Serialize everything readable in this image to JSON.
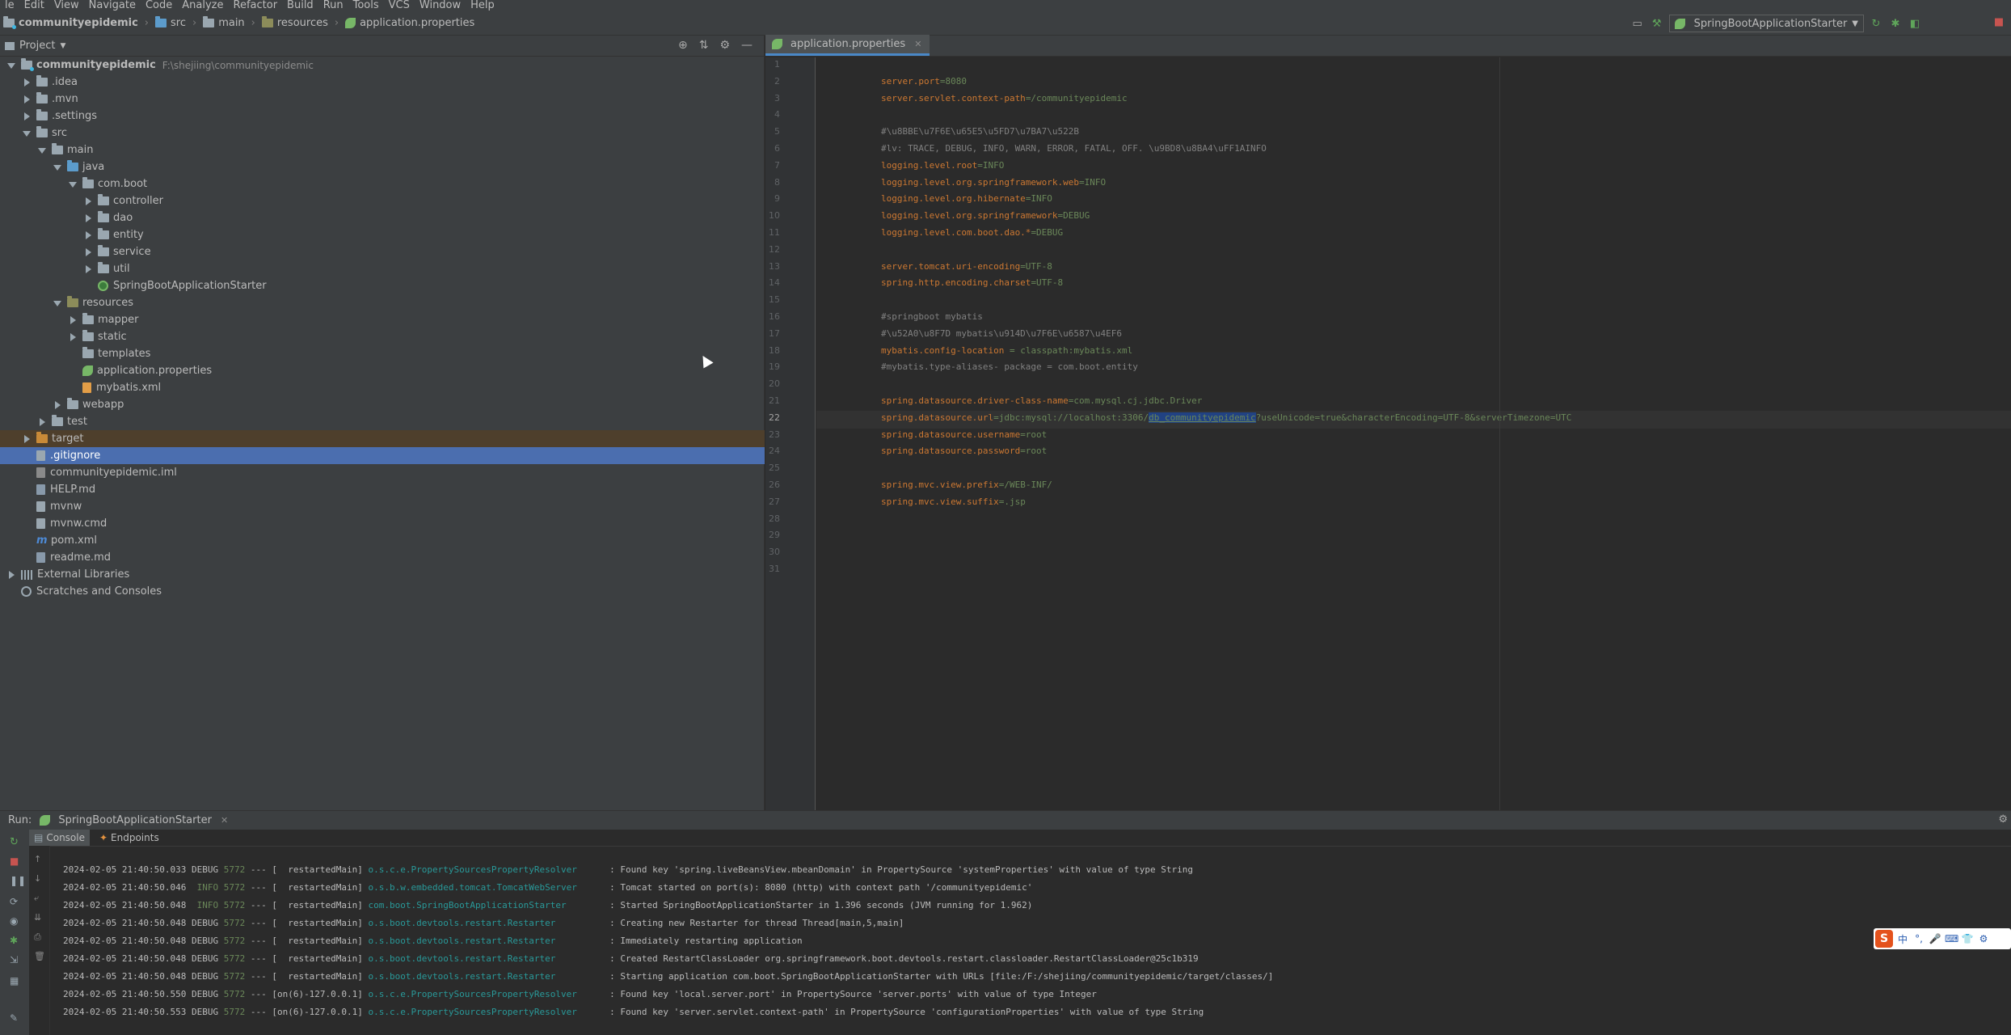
{
  "menu": [
    "le",
    "Edit",
    "View",
    "Navigate",
    "Code",
    "Analyze",
    "Refactor",
    "Build",
    "Run",
    "Tools",
    "VCS",
    "Window",
    "Help"
  ],
  "breadcrumbs": [
    "communityepidemic",
    "src",
    "main",
    "resources",
    "application.properties"
  ],
  "run_config": {
    "name": "SpringBootApplicationStarter"
  },
  "project_pane": {
    "title": "Project",
    "tree": [
      {
        "label": "communityepidemic",
        "path": "F:\\shejiing\\communityepidemic"
      },
      {
        "label": ".idea"
      },
      {
        "label": ".mvn"
      },
      {
        "label": ".settings"
      },
      {
        "label": "src"
      },
      {
        "label": "main"
      },
      {
        "label": "java"
      },
      {
        "label": "com.boot"
      },
      {
        "label": "controller"
      },
      {
        "label": "dao"
      },
      {
        "label": "entity"
      },
      {
        "label": "service"
      },
      {
        "label": "util"
      },
      {
        "label": "SpringBootApplicationStarter"
      },
      {
        "label": "resources"
      },
      {
        "label": "mapper"
      },
      {
        "label": "static"
      },
      {
        "label": "templates"
      },
      {
        "label": "application.properties"
      },
      {
        "label": "mybatis.xml"
      },
      {
        "label": "webapp"
      },
      {
        "label": "test"
      },
      {
        "label": "target"
      },
      {
        "label": ".gitignore"
      },
      {
        "label": "communityepidemic.iml"
      },
      {
        "label": "HELP.md"
      },
      {
        "label": "mvnw"
      },
      {
        "label": "mvnw.cmd"
      },
      {
        "label": "pom.xml"
      },
      {
        "label": "readme.md"
      },
      {
        "label": "External Libraries"
      },
      {
        "label": "Scratches and Consoles"
      }
    ]
  },
  "editor": {
    "tab": "application.properties",
    "lines": [
      "",
      "server.port=8080",
      "server.servlet.context-path=/communityepidemic",
      "",
      "#\\u8BBE\\u7F6E\\u65E5\\u5FD7\\u7BA7\\u522B",
      "#lv: TRACE, DEBUG, INFO, WARN, ERROR, FATAL, OFF. \\u9BD8\\u8BA4\\uFF1AINFO",
      "logging.level.root=INFO",
      "logging.level.org.springframework.web=INFO",
      "logging.level.org.hibernate=INFO",
      "logging.level.org.springframework=DEBUG",
      "logging.level.com.boot.dao.*=DEBUG",
      "",
      "server.tomcat.uri-encoding=UTF-8",
      "spring.http.encoding.charset=UTF-8",
      "",
      "#springboot mybatis",
      "#\\u52A0\\u8F7D mybatis\\u914D\\u7F6E\\u6587\\u4EF6",
      "mybatis.config-location = classpath:mybatis.xml",
      "#mybatis.type-aliases- package = com.boot.entity",
      "",
      "spring.datasource.driver-class-name=com.mysql.cj.jdbc.Driver",
      "spring.datasource.url=jdbc:mysql://localhost:3306/db_communityepidemic?useUnicode=true&characterEncoding=UTF-8&serverTimezone=UTC",
      "spring.datasource.username=root",
      "spring.datasource.password=root",
      "",
      "spring.mvc.view.prefix=/WEB-INF/",
      "spring.mvc.view.suffix=.jsp",
      "",
      "",
      "",
      ""
    ],
    "current_line": 22
  },
  "run_panel": {
    "label": "Run:",
    "tab": "SpringBootApplicationStarter",
    "subtabs": [
      "Console",
      "Endpoints"
    ],
    "logs": [
      {
        "ts": "2024-02-05 21:40:50.033",
        "level": "DEBUG",
        "pid": "5772",
        "sep": "---",
        "thread": "[  restartedMain]",
        "logger": "o.s.c.e.PropertySourcesPropertyResolver",
        "msg": ": Found key 'spring.liveBeansView.mbeanDomain' in PropertySource 'systemProperties' with value of type String"
      },
      {
        "ts": "2024-02-05 21:40:50.046",
        "level": " INFO",
        "pid": "5772",
        "sep": "---",
        "thread": "[  restartedMain]",
        "logger": "o.s.b.w.embedded.tomcat.TomcatWebServer",
        "msg": ": Tomcat started on port(s): 8080 (http) with context path '/communityepidemic'"
      },
      {
        "ts": "2024-02-05 21:40:50.048",
        "level": " INFO",
        "pid": "5772",
        "sep": "---",
        "thread": "[  restartedMain]",
        "logger": "com.boot.SpringBootApplicationStarter",
        "msg": ": Started SpringBootApplicationStarter in 1.396 seconds (JVM running for 1.962)"
      },
      {
        "ts": "2024-02-05 21:40:50.048",
        "level": "DEBUG",
        "pid": "5772",
        "sep": "---",
        "thread": "[  restartedMain]",
        "logger": "o.s.boot.devtools.restart.Restarter",
        "msg": ": Creating new Restarter for thread Thread[main,5,main]"
      },
      {
        "ts": "2024-02-05 21:40:50.048",
        "level": "DEBUG",
        "pid": "5772",
        "sep": "---",
        "thread": "[  restartedMain]",
        "logger": "o.s.boot.devtools.restart.Restarter",
        "msg": ": Immediately restarting application"
      },
      {
        "ts": "2024-02-05 21:40:50.048",
        "level": "DEBUG",
        "pid": "5772",
        "sep": "---",
        "thread": "[  restartedMain]",
        "logger": "o.s.boot.devtools.restart.Restarter",
        "msg": ": Created RestartClassLoader org.springframework.boot.devtools.restart.classloader.RestartClassLoader@25c1b319"
      },
      {
        "ts": "2024-02-05 21:40:50.048",
        "level": "DEBUG",
        "pid": "5772",
        "sep": "---",
        "thread": "[  restartedMain]",
        "logger": "o.s.boot.devtools.restart.Restarter",
        "msg": ": Starting application com.boot.SpringBootApplicationStarter with URLs [file:/F:/shejiing/communityepidemic/target/classes/]"
      },
      {
        "ts": "2024-02-05 21:40:50.550",
        "level": "DEBUG",
        "pid": "5772",
        "sep": "---",
        "thread": "[on(6)-127.0.0.1]",
        "logger": "o.s.c.e.PropertySourcesPropertyResolver",
        "msg": ": Found key 'local.server.port' in PropertySource 'server.ports' with value of type Integer"
      },
      {
        "ts": "2024-02-05 21:40:50.553",
        "level": "DEBUG",
        "pid": "5772",
        "sep": "---",
        "thread": "[on(6)-127.0.0.1]",
        "logger": "o.s.c.e.PropertySourcesPropertyResolver",
        "msg": ": Found key 'server.servlet.context-path' in PropertySource 'configurationProperties' with value of type String"
      }
    ]
  },
  "ime": {
    "logo": "S",
    "items": [
      "中",
      "°,",
      "🎤",
      "⌨",
      "👕",
      "⚙"
    ]
  },
  "colors": {
    "accent": "#4a88c7",
    "selection": "#4b6eaf",
    "keyword": "#cc7832",
    "string": "#6a8759",
    "comment": "#808080",
    "logger": "#299999"
  }
}
